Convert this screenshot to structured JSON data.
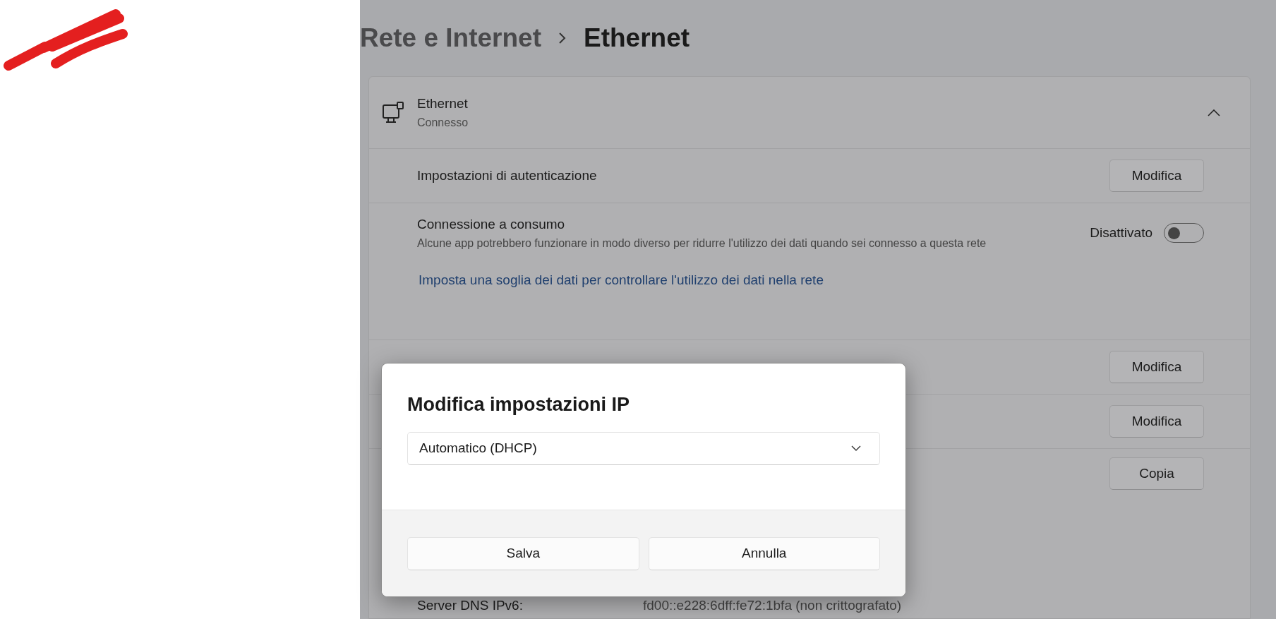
{
  "breadcrumb": [
    {
      "text": "Rete e Internet",
      "current": false
    },
    {
      "text": "Ethernet",
      "current": true
    }
  ],
  "card": {
    "title": "Ethernet",
    "status": "Connesso",
    "expanded": true,
    "rows": [
      {
        "kind": "button",
        "label": "Impostazioni di autenticazione",
        "button": "Modifica"
      },
      {
        "kind": "toggle",
        "label": "Connessione a consumo",
        "description": "Alcune app potrebbero funzionare in modo diverso per ridurre l'utilizzo dei dati quando sei connesso a questa rete",
        "state_text": "Disattivato",
        "on": false,
        "link": "Imposta una soglia dei dati per controllare l'utilizzo dei dati nella rete"
      },
      {
        "kind": "button",
        "button": "Modifica"
      },
      {
        "kind": "button",
        "button": "Modifica"
      },
      {
        "kind": "properties",
        "button": "Copia",
        "properties": [
          {
            "label": "Server DNS IPv6:",
            "value": "fd00::e228:6dff:fe72:1bfa (non crittografato)"
          }
        ]
      }
    ]
  },
  "dialog": {
    "title": "Modifica impostazioni IP",
    "dropdown": {
      "value": "Automatico (DHCP)"
    },
    "buttons": [
      "Salva",
      "Annulla"
    ]
  }
}
